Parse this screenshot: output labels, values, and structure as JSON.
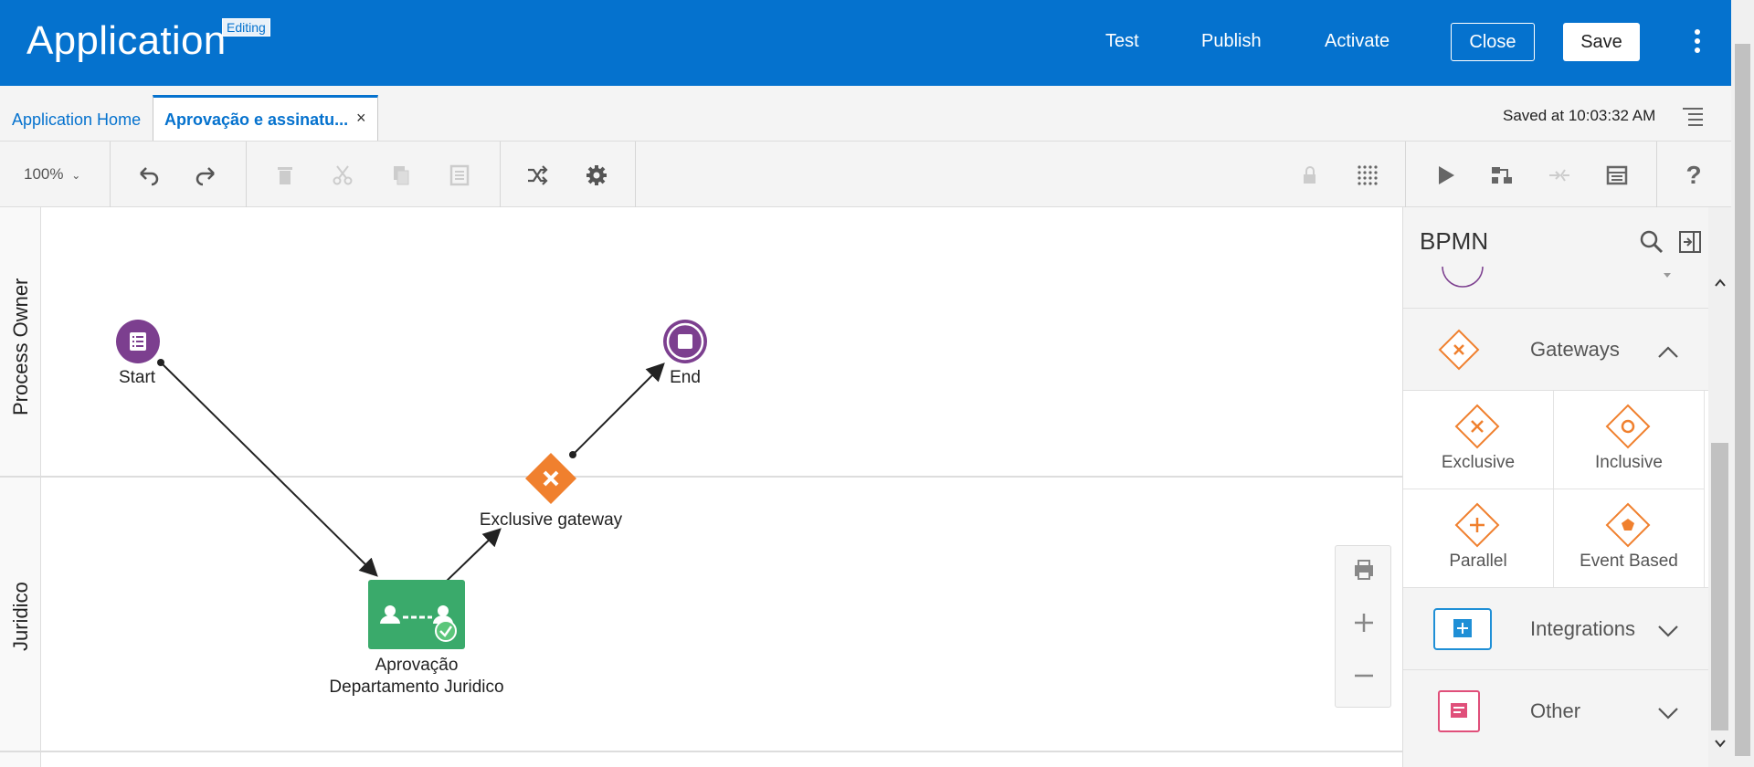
{
  "header": {
    "title": "Application",
    "badge": "Editing",
    "links": {
      "test": "Test",
      "publish": "Publish",
      "activate": "Activate"
    },
    "close_label": "Close",
    "save_label": "Save",
    "brand_color": "#0572ce"
  },
  "tabs": {
    "home": "Application Home",
    "active": "Aprovação e assinatu...",
    "close_glyph": "×",
    "saved_status": "Saved at 10:03:32 AM"
  },
  "toolbar": {
    "zoom": "100%",
    "icons": [
      "undo-icon",
      "redo-icon",
      "delete-icon",
      "cut-icon",
      "copy-icon",
      "paste-icon",
      "shuffle-icon",
      "settings-icon",
      "lock-icon",
      "grid-icon",
      "play-icon",
      "flow-icon",
      "merge-icon",
      "table-icon",
      "help-icon"
    ]
  },
  "canvas": {
    "lanes": [
      "Process Owner",
      "Juridico"
    ],
    "nodes": {
      "start": "Start",
      "end": "End",
      "gateway": "Exclusive gateway",
      "task_line1": "Aprovação",
      "task_line2": "Departamento Juridico"
    },
    "colors": {
      "event": "#7c3f8f",
      "gateway": "#f0802e",
      "task": "#3aaa6b"
    }
  },
  "palette": {
    "title": "BPMN",
    "sections": {
      "gateways": "Gateways",
      "integrations": "Integrations",
      "other": "Other"
    },
    "gateway_items": {
      "exclusive": "Exclusive",
      "inclusive": "Inclusive",
      "parallel": "Parallel",
      "event_based": "Event Based"
    }
  }
}
